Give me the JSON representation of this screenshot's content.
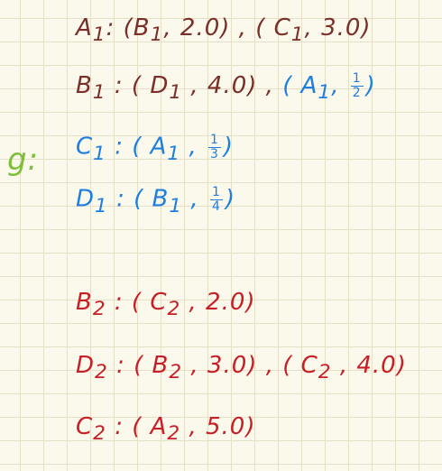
{
  "graph_label": "g:",
  "g1": {
    "a1": {
      "open": "A",
      "sub": "1",
      "rest": ": (B",
      "sub2": "1",
      "tail": ", 2.0) , ( C",
      "sub3": "1",
      "end": ", 3.0)"
    },
    "b1": {
      "head": "B",
      "sub": "1",
      "mid": " : ( D",
      "sub2": "1",
      "mid2": " , 4.0) ,",
      "blue_head": " ( A",
      "blue_sub": "1",
      "blue_comma": ",",
      "num": "1",
      "den": "2",
      "blue_end": ")"
    },
    "c1": {
      "head": "C",
      "sub": "1",
      "mid": " : ( A",
      "sub2": "1",
      "comma": " ,",
      "num": "1",
      "den": "3",
      "end": ")"
    },
    "d1": {
      "head": "D",
      "sub": "1",
      "mid": " : ( B",
      "sub2": "1",
      "comma": " ,",
      "num": "1",
      "den": "4",
      "end": ")"
    }
  },
  "g2": {
    "b2": {
      "head": "B",
      "sub": "2",
      "mid": " : ( C",
      "sub2": "2",
      "end": " , 2.0)"
    },
    "d2": {
      "head": "D",
      "sub": "2",
      "mid": " : ( B",
      "sub2": "2",
      "mid2": " , 3.0) , ( C",
      "sub3": "2",
      "end": " , 4.0)"
    },
    "c2": {
      "head": "C",
      "sub": "2",
      "mid": " : ( A",
      "sub2": "2",
      "end": " , 5.0)"
    }
  },
  "colors": {
    "brown": "#7a2f28",
    "blue": "#1e7fe0",
    "red": "#c81f26",
    "green": "#7dbf3a"
  }
}
